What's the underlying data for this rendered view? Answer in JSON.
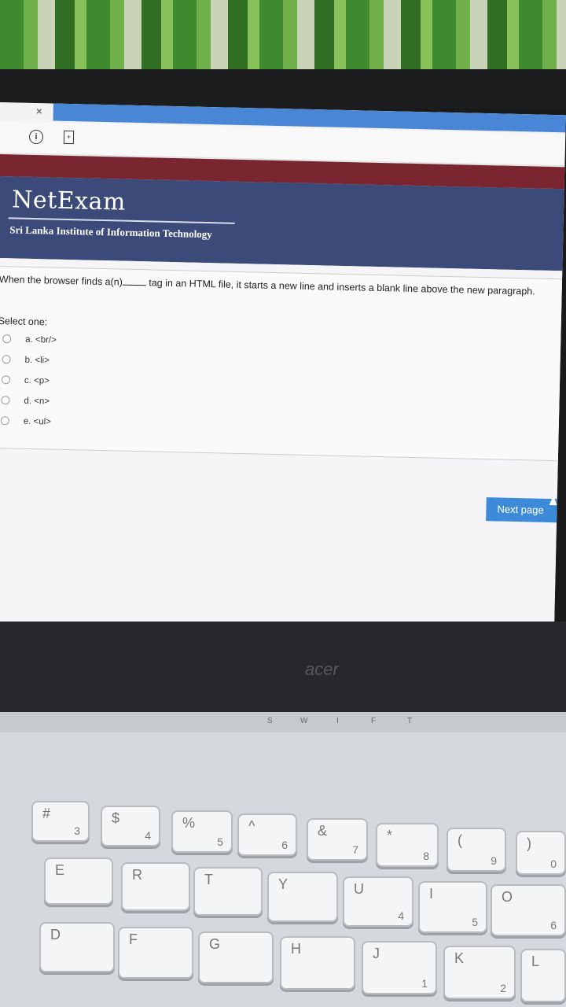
{
  "browser": {
    "close_glyph": "×"
  },
  "header": {
    "logo": "NetExam",
    "subtitle": "Sri Lanka Institute of Information Technology"
  },
  "question": {
    "text_before": "When the browser finds a(n)",
    "text_after": "tag in an HTML file, it starts a new line and inserts a blank line above the new paragraph.",
    "prompt": "Select one:",
    "options": [
      {
        "label": "a. <br/>"
      },
      {
        "label": "b. <li>"
      },
      {
        "label": "c. <p>"
      },
      {
        "label": "d. <n>"
      },
      {
        "label": "e. <ul>"
      }
    ]
  },
  "navigation": {
    "next_label": "Next page"
  },
  "laptop": {
    "brand": "acer",
    "status_letters": [
      "S",
      "W",
      "I",
      "F",
      "T"
    ],
    "keys": [
      {
        "main": "#",
        "sub": "3"
      },
      {
        "main": "$",
        "sub": "4"
      },
      {
        "main": "%",
        "sub": "5"
      },
      {
        "main": "^",
        "sub": "6"
      },
      {
        "main": "&",
        "sub": "7"
      },
      {
        "main": "*",
        "sub": "8"
      },
      {
        "main": "(",
        "sub": "9"
      },
      {
        "main": ")",
        "sub": "0"
      },
      {
        "main": "E",
        "sub": ""
      },
      {
        "main": "R",
        "sub": ""
      },
      {
        "main": "T",
        "sub": ""
      },
      {
        "main": "Y",
        "sub": ""
      },
      {
        "main": "U",
        "sub": "4"
      },
      {
        "main": "I",
        "sub": "5"
      },
      {
        "main": "O",
        "sub": "6"
      },
      {
        "main": "D",
        "sub": ""
      },
      {
        "main": "F",
        "sub": ""
      },
      {
        "main": "G",
        "sub": ""
      },
      {
        "main": "H",
        "sub": ""
      },
      {
        "main": "J",
        "sub": "1"
      },
      {
        "main": "K",
        "sub": "2"
      },
      {
        "main": "L",
        "sub": ""
      }
    ]
  }
}
